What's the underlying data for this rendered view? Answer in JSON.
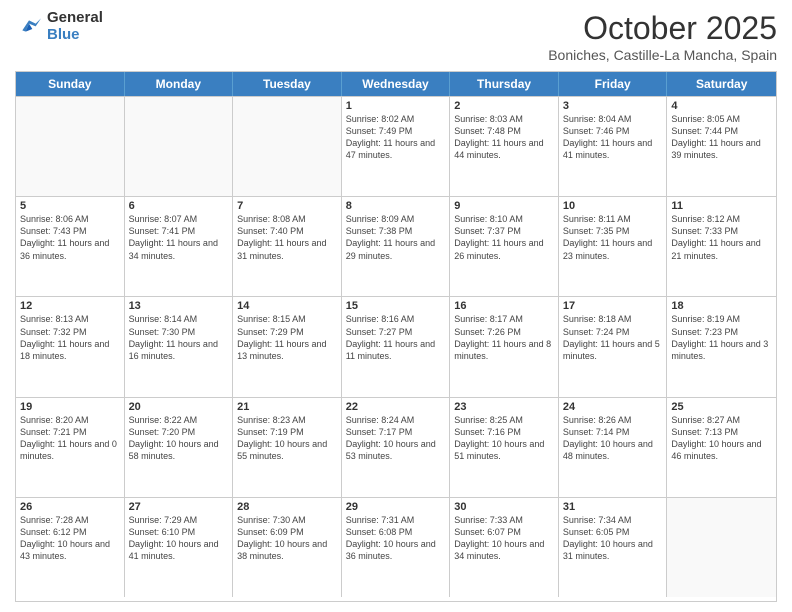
{
  "header": {
    "logo_general": "General",
    "logo_blue": "Blue",
    "month_title": "October 2025",
    "location": "Boniches, Castille-La Mancha, Spain"
  },
  "weekdays": [
    "Sunday",
    "Monday",
    "Tuesday",
    "Wednesday",
    "Thursday",
    "Friday",
    "Saturday"
  ],
  "weeks": [
    [
      {
        "day": "",
        "info": ""
      },
      {
        "day": "",
        "info": ""
      },
      {
        "day": "",
        "info": ""
      },
      {
        "day": "1",
        "info": "Sunrise: 8:02 AM\nSunset: 7:49 PM\nDaylight: 11 hours and 47 minutes."
      },
      {
        "day": "2",
        "info": "Sunrise: 8:03 AM\nSunset: 7:48 PM\nDaylight: 11 hours and 44 minutes."
      },
      {
        "day": "3",
        "info": "Sunrise: 8:04 AM\nSunset: 7:46 PM\nDaylight: 11 hours and 41 minutes."
      },
      {
        "day": "4",
        "info": "Sunrise: 8:05 AM\nSunset: 7:44 PM\nDaylight: 11 hours and 39 minutes."
      }
    ],
    [
      {
        "day": "5",
        "info": "Sunrise: 8:06 AM\nSunset: 7:43 PM\nDaylight: 11 hours and 36 minutes."
      },
      {
        "day": "6",
        "info": "Sunrise: 8:07 AM\nSunset: 7:41 PM\nDaylight: 11 hours and 34 minutes."
      },
      {
        "day": "7",
        "info": "Sunrise: 8:08 AM\nSunset: 7:40 PM\nDaylight: 11 hours and 31 minutes."
      },
      {
        "day": "8",
        "info": "Sunrise: 8:09 AM\nSunset: 7:38 PM\nDaylight: 11 hours and 29 minutes."
      },
      {
        "day": "9",
        "info": "Sunrise: 8:10 AM\nSunset: 7:37 PM\nDaylight: 11 hours and 26 minutes."
      },
      {
        "day": "10",
        "info": "Sunrise: 8:11 AM\nSunset: 7:35 PM\nDaylight: 11 hours and 23 minutes."
      },
      {
        "day": "11",
        "info": "Sunrise: 8:12 AM\nSunset: 7:33 PM\nDaylight: 11 hours and 21 minutes."
      }
    ],
    [
      {
        "day": "12",
        "info": "Sunrise: 8:13 AM\nSunset: 7:32 PM\nDaylight: 11 hours and 18 minutes."
      },
      {
        "day": "13",
        "info": "Sunrise: 8:14 AM\nSunset: 7:30 PM\nDaylight: 11 hours and 16 minutes."
      },
      {
        "day": "14",
        "info": "Sunrise: 8:15 AM\nSunset: 7:29 PM\nDaylight: 11 hours and 13 minutes."
      },
      {
        "day": "15",
        "info": "Sunrise: 8:16 AM\nSunset: 7:27 PM\nDaylight: 11 hours and 11 minutes."
      },
      {
        "day": "16",
        "info": "Sunrise: 8:17 AM\nSunset: 7:26 PM\nDaylight: 11 hours and 8 minutes."
      },
      {
        "day": "17",
        "info": "Sunrise: 8:18 AM\nSunset: 7:24 PM\nDaylight: 11 hours and 5 minutes."
      },
      {
        "day": "18",
        "info": "Sunrise: 8:19 AM\nSunset: 7:23 PM\nDaylight: 11 hours and 3 minutes."
      }
    ],
    [
      {
        "day": "19",
        "info": "Sunrise: 8:20 AM\nSunset: 7:21 PM\nDaylight: 11 hours and 0 minutes."
      },
      {
        "day": "20",
        "info": "Sunrise: 8:22 AM\nSunset: 7:20 PM\nDaylight: 10 hours and 58 minutes."
      },
      {
        "day": "21",
        "info": "Sunrise: 8:23 AM\nSunset: 7:19 PM\nDaylight: 10 hours and 55 minutes."
      },
      {
        "day": "22",
        "info": "Sunrise: 8:24 AM\nSunset: 7:17 PM\nDaylight: 10 hours and 53 minutes."
      },
      {
        "day": "23",
        "info": "Sunrise: 8:25 AM\nSunset: 7:16 PM\nDaylight: 10 hours and 51 minutes."
      },
      {
        "day": "24",
        "info": "Sunrise: 8:26 AM\nSunset: 7:14 PM\nDaylight: 10 hours and 48 minutes."
      },
      {
        "day": "25",
        "info": "Sunrise: 8:27 AM\nSunset: 7:13 PM\nDaylight: 10 hours and 46 minutes."
      }
    ],
    [
      {
        "day": "26",
        "info": "Sunrise: 7:28 AM\nSunset: 6:12 PM\nDaylight: 10 hours and 43 minutes."
      },
      {
        "day": "27",
        "info": "Sunrise: 7:29 AM\nSunset: 6:10 PM\nDaylight: 10 hours and 41 minutes."
      },
      {
        "day": "28",
        "info": "Sunrise: 7:30 AM\nSunset: 6:09 PM\nDaylight: 10 hours and 38 minutes."
      },
      {
        "day": "29",
        "info": "Sunrise: 7:31 AM\nSunset: 6:08 PM\nDaylight: 10 hours and 36 minutes."
      },
      {
        "day": "30",
        "info": "Sunrise: 7:33 AM\nSunset: 6:07 PM\nDaylight: 10 hours and 34 minutes."
      },
      {
        "day": "31",
        "info": "Sunrise: 7:34 AM\nSunset: 6:05 PM\nDaylight: 10 hours and 31 minutes."
      },
      {
        "day": "",
        "info": ""
      }
    ]
  ]
}
